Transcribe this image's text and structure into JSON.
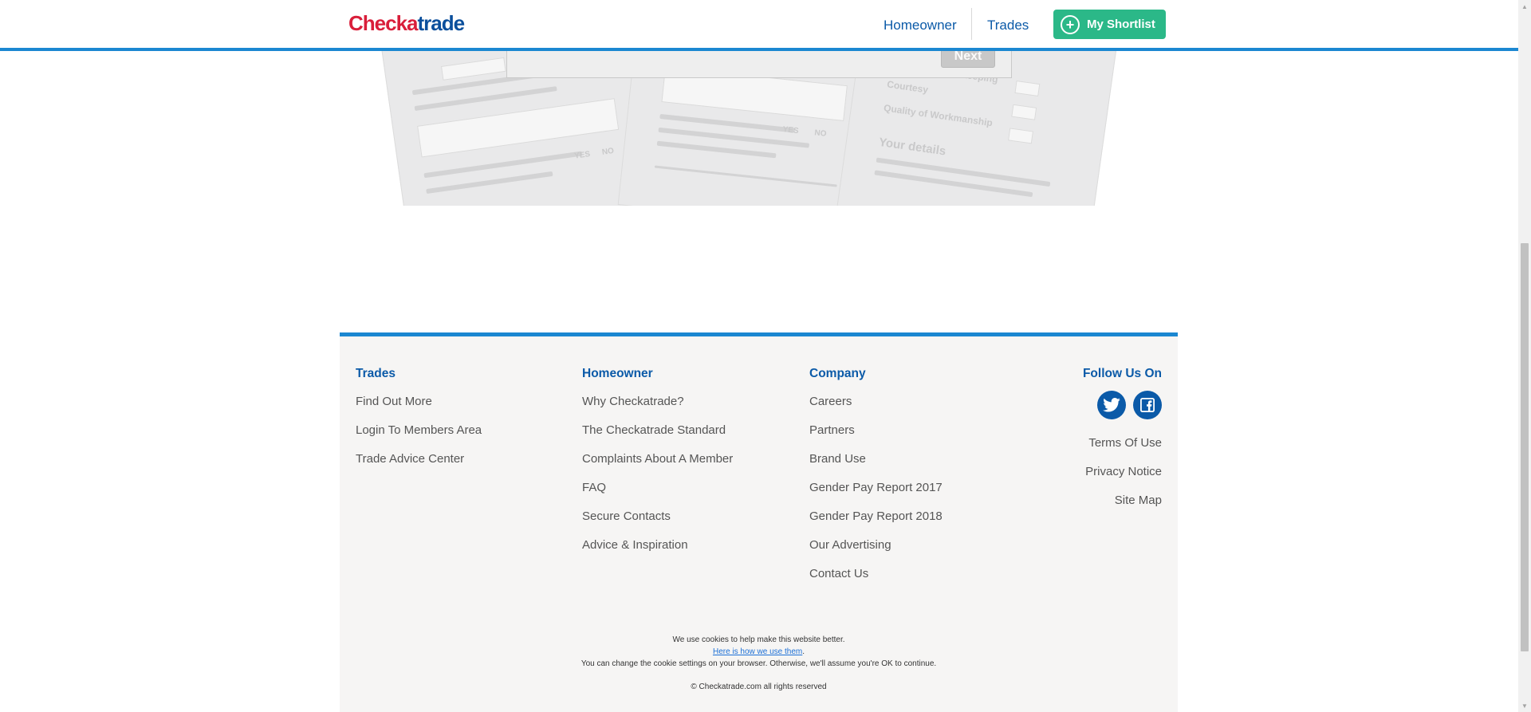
{
  "header": {
    "logo": {
      "part1": "Chec",
      "part2": "k",
      "part3": "a",
      "part4": "trade"
    },
    "nav": {
      "homeowner": "Homeowner",
      "trades": "Trades"
    },
    "shortlist": "My Shortlist"
  },
  "hero": {
    "next_button": "Next",
    "ghost": {
      "details": "Your details",
      "courtesy": "Courtesy",
      "workmanship": "Quality of Workmanship",
      "timekeeping": "Tidiness / Time Keeping",
      "yes": "YES",
      "no": "NO"
    }
  },
  "footer": {
    "trades": {
      "title": "Trades",
      "links": [
        "Find Out More",
        "Login To Members Area",
        "Trade Advice Center"
      ]
    },
    "homeowner": {
      "title": "Homeowner",
      "links": [
        "Why Checkatrade?",
        "The Checkatrade Standard",
        "Complaints About A Member",
        "FAQ",
        "Secure Contacts",
        "Advice & Inspiration"
      ]
    },
    "company": {
      "title": "Company",
      "links": [
        "Careers",
        "Partners",
        "Brand Use",
        "Gender Pay Report 2017",
        "Gender Pay Report 2018",
        "Our Advertising",
        "Contact Us"
      ]
    },
    "follow": {
      "title": "Follow Us On",
      "icons": [
        "twitter-icon",
        "facebook-icon"
      ],
      "links": [
        "Terms Of Use",
        "Privacy Notice",
        "Site Map"
      ]
    },
    "cookies": {
      "line1": "We use cookies to help make this website better.",
      "link": "Here is how we use them",
      "link_suffix": ".",
      "line3": "You can change the cookie settings on your browser.  Otherwise, we'll assume you're OK to continue."
    },
    "copyright": "© Checkatrade.com all rights reserved"
  },
  "colors": {
    "brand_blue": "#0b5aa8",
    "accent_line": "#1b87d1",
    "brand_red": "#d91e3a",
    "shortlist_green": "#2bb888",
    "footer_bg": "#f6f5f4"
  }
}
